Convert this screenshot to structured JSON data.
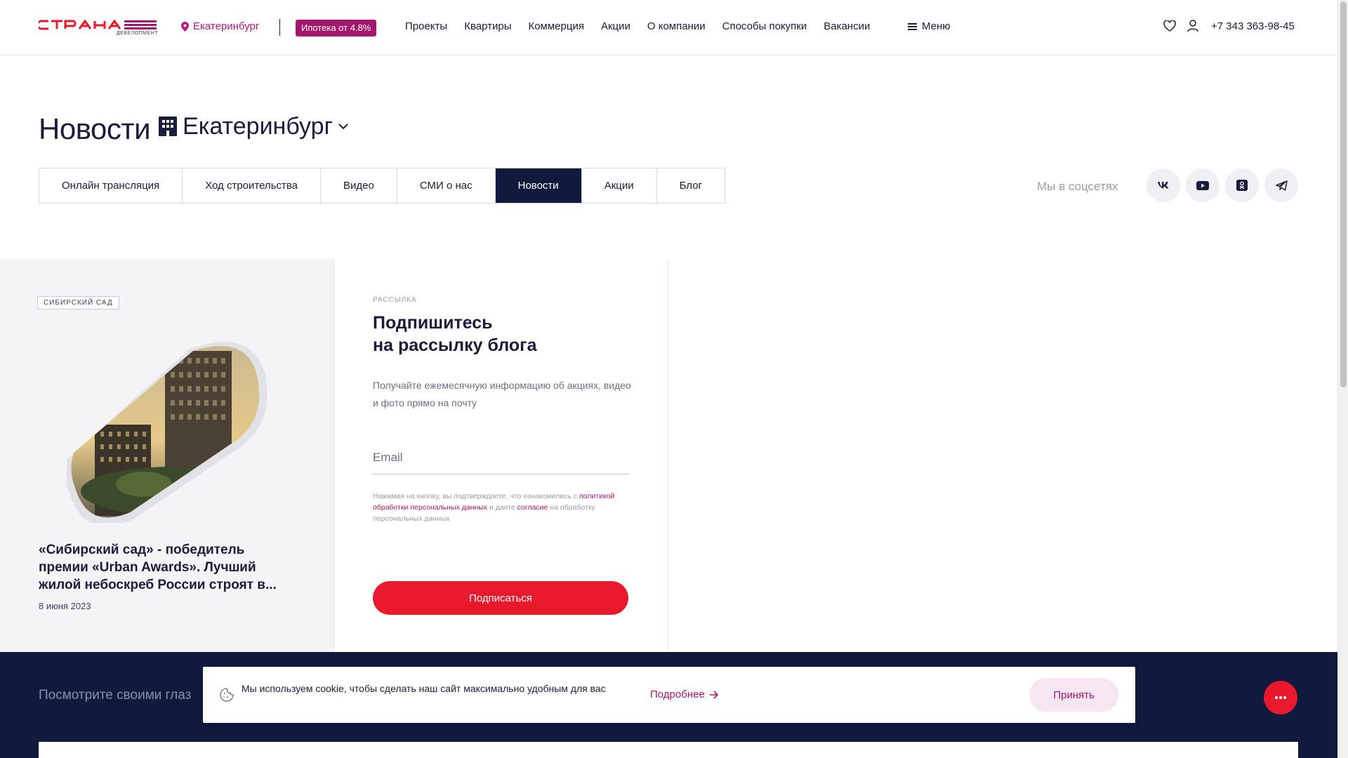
{
  "header": {
    "logo_sub": "ДЕВЕЛОПМЕНТ",
    "city": "Екатеринбург",
    "mortgage": "Ипотека от 4.8%",
    "nav": [
      "Проекты",
      "Квартиры",
      "Коммерция",
      "Акции",
      "О компании",
      "Способы покупки",
      "Вакансии"
    ],
    "menu": "Меню",
    "phone": "+7 343 363-98-45"
  },
  "title": {
    "page_title": "Новости",
    "city_select": "Екатеринбург"
  },
  "tabs": [
    {
      "label": "Онлайн трансляция",
      "active": false
    },
    {
      "label": "Ход строительства",
      "active": false
    },
    {
      "label": "Видео",
      "active": false
    },
    {
      "label": "СМИ о нас",
      "active": false
    },
    {
      "label": "Новости",
      "active": true
    },
    {
      "label": "Акции",
      "active": false
    },
    {
      "label": "Блог",
      "active": false
    }
  ],
  "socials": {
    "label": "Мы в соцсетях",
    "icons": [
      "vk-icon",
      "youtube-icon",
      "odnoklassniki-icon",
      "telegram-icon"
    ]
  },
  "news_card": {
    "tag": "СИБИРСКИЙ САД",
    "title": "«Сибирский сад» - победитель премии «Urban Awards». Лучший жилой небоскреб России строят в...",
    "date": "8 июня 2023"
  },
  "subscribe": {
    "kicker": "РАССЫЛКА",
    "title_line1": "Подпишитесь",
    "title_line2": "на рассылку блога",
    "description": "Получайте ежемесячную информацию об акциях, видео и фото прямо на почту",
    "email_placeholder": "Email",
    "consent_prefix": "Нажимая на кнопку, вы подтверждаете, что ознакомились с",
    "consent_link1": "политикой обработки персональных данных",
    "consent_mid": "и даете",
    "consent_link2": "согласие",
    "consent_suffix": "на обработку персональных данных",
    "button": "Подписаться"
  },
  "band": {
    "text": "Посмотрите своими глаз"
  },
  "cookie": {
    "text": "Мы используем cookie, чтобы сделать наш сайт максимально удобным для вас",
    "more": "Подробнее",
    "accept": "Принять"
  },
  "colors": {
    "brand": "#a3176e",
    "accent_red": "#e8192c",
    "navy": "#101a3d"
  }
}
